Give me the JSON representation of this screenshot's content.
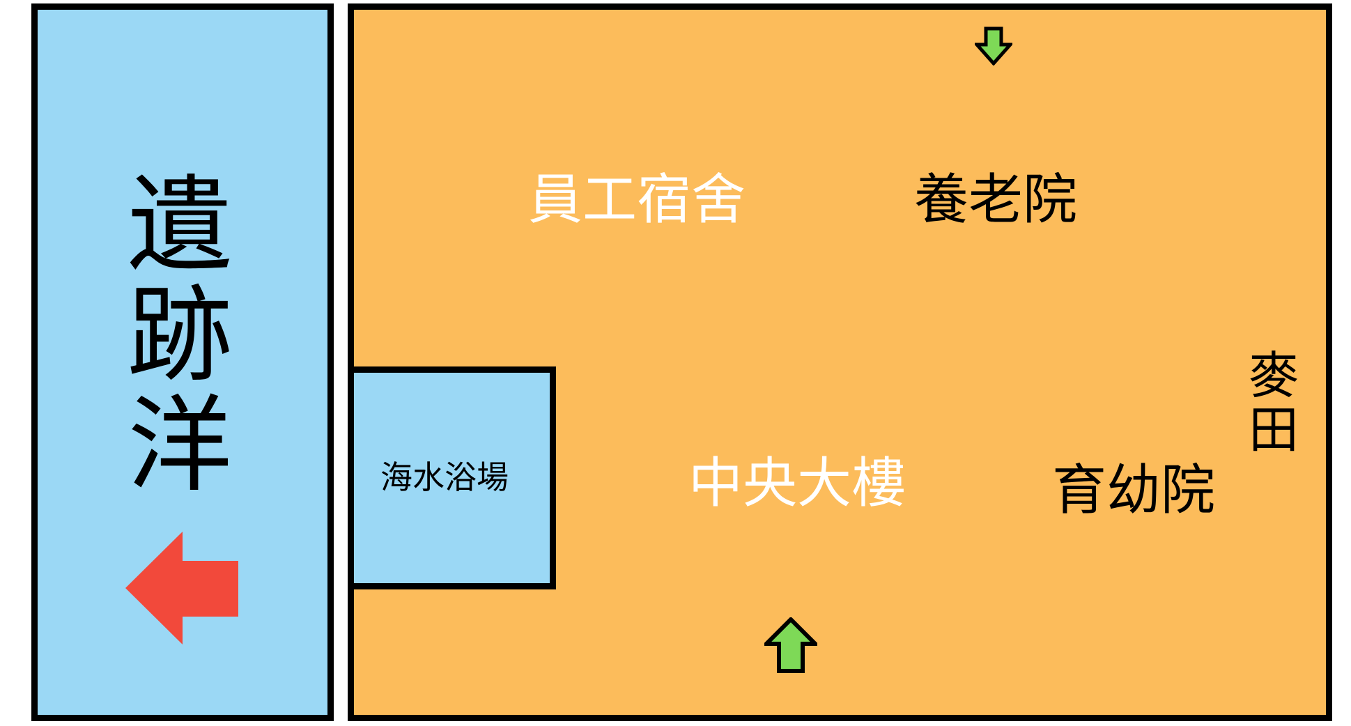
{
  "colors": {
    "ocean": "#9bd8f5",
    "land": "#fcbc5b",
    "border": "#000000",
    "label_white": "#ffffff",
    "label_black": "#000000",
    "exit_arrow": "#f2493b",
    "entrance_arrow": "#7ed957"
  },
  "ocean": {
    "label": "遺跡洋",
    "exit_arrow_icon": "arrow-left-icon"
  },
  "land": {
    "labels": {
      "dorm": "員工宿舍",
      "elder_home": "養老院",
      "central_building": "中央大樓",
      "orphanage": "育幼院",
      "wheat_field": "麥田",
      "beach": "海水浴場"
    },
    "label_colors": {
      "dorm": "#ffffff",
      "elder_home": "#000000",
      "central_building": "#ffffff",
      "orphanage": "#000000",
      "wheat_field": "#000000",
      "beach": "#000000"
    },
    "arrows": {
      "top": "arrow-down-icon",
      "bottom": "arrow-up-icon"
    }
  }
}
